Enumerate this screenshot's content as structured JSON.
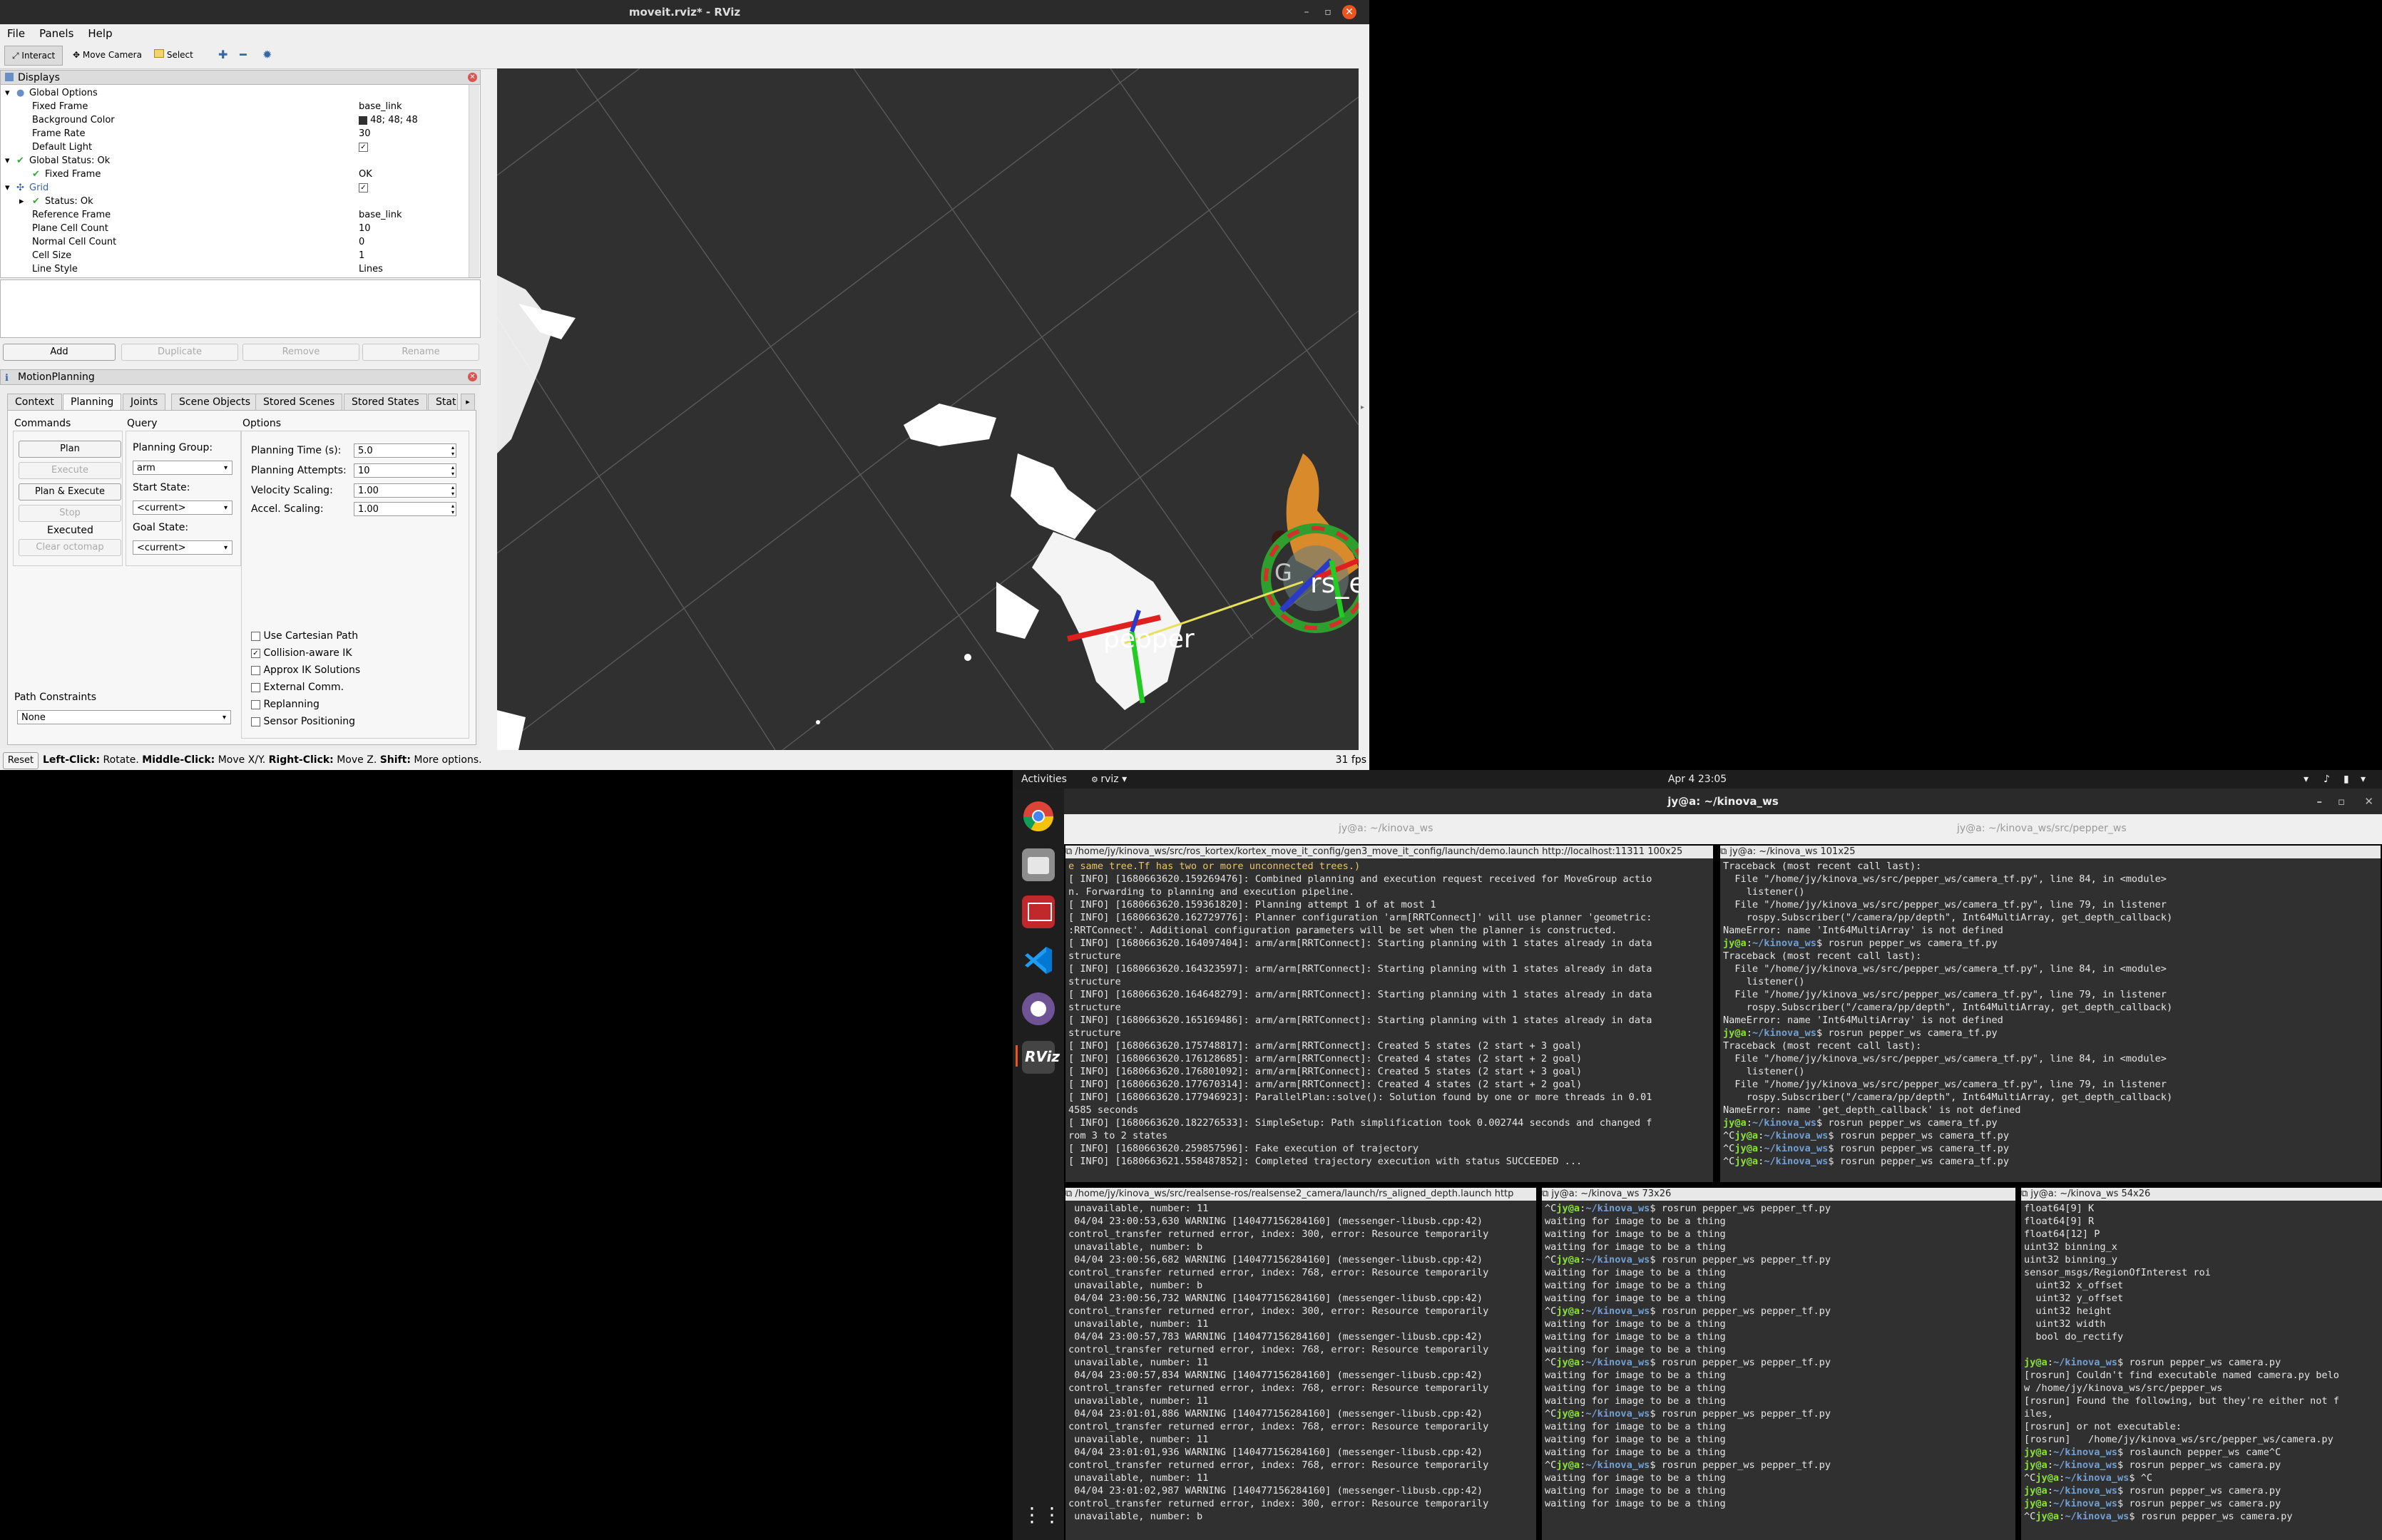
{
  "rviz": {
    "window_title": "moveit.rviz* - RViz",
    "menu": [
      "File",
      "Panels",
      "Help"
    ],
    "toolbar": {
      "interact": "Interact",
      "move_camera": "Move Camera",
      "select": "Select"
    },
    "displays": {
      "title": "Displays",
      "rows": [
        {
          "name": "Global Options",
          "value": ""
        },
        {
          "name": "Fixed Frame",
          "value": "base_link"
        },
        {
          "name": "Background Color",
          "value": "48; 48; 48"
        },
        {
          "name": "Frame Rate",
          "value": "30"
        },
        {
          "name": "Default Light",
          "value": ""
        },
        {
          "name": "Global Status: Ok",
          "value": ""
        },
        {
          "name": "Fixed Frame",
          "value": "OK"
        },
        {
          "name": "Grid",
          "value": ""
        },
        {
          "name": "Status: Ok",
          "value": ""
        },
        {
          "name": "Reference Frame",
          "value": "base_link"
        },
        {
          "name": "Plane Cell Count",
          "value": "10"
        },
        {
          "name": "Normal Cell Count",
          "value": "0"
        },
        {
          "name": "Cell Size",
          "value": "1"
        },
        {
          "name": "Line Style",
          "value": "Lines"
        }
      ],
      "buttons": {
        "add": "Add",
        "duplicate": "Duplicate",
        "remove": "Remove",
        "rename": "Rename"
      }
    },
    "motion_planning": {
      "title": "MotionPlanning",
      "tabs": [
        "Context",
        "Planning",
        "Joints",
        "Scene Objects",
        "Stored Scenes",
        "Stored States",
        "Stat"
      ],
      "commands": {
        "label": "Commands",
        "plan": "Plan",
        "execute": "Execute",
        "plan_execute": "Plan & Execute",
        "stop": "Stop",
        "status": "Executed",
        "clear_octomap": "Clear octomap"
      },
      "query": {
        "label": "Query",
        "planning_group_label": "Planning Group:",
        "planning_group": "arm",
        "start_state_label": "Start State:",
        "start_state": "<current>",
        "goal_state_label": "Goal State:",
        "goal_state": "<current>"
      },
      "options": {
        "label": "Options",
        "planning_time_label": "Planning Time (s):",
        "planning_time": "5.0",
        "planning_attempts_label": "Planning Attempts:",
        "planning_attempts": "10",
        "velocity_scaling_label": "Velocity Scaling:",
        "velocity_scaling": "1.00",
        "accel_scaling_label": "Accel. Scaling:",
        "accel_scaling": "1.00",
        "checkboxes": [
          {
            "label": "Use Cartesian Path",
            "checked": false
          },
          {
            "label": "Collision-aware IK",
            "checked": true
          },
          {
            "label": "Approx IK Solutions",
            "checked": false
          },
          {
            "label": "External Comm.",
            "checked": false
          },
          {
            "label": "Replanning",
            "checked": false
          },
          {
            "label": "Sensor Positioning",
            "checked": false
          }
        ]
      },
      "path_constraints_label": "Path Constraints",
      "path_constraints": "None"
    },
    "viewport": {
      "label_rs_ee": "rs_ee",
      "label_pepper": "pepper",
      "label_g": "G"
    },
    "statusbar": {
      "reset": "Reset",
      "hint_left": "Left-Click:",
      "hint_left_text": " Rotate. ",
      "hint_middle": "Middle-Click:",
      "hint_middle_text": " Move X/Y. ",
      "hint_right": "Right-Click:",
      "hint_right_text": " Move Z. ",
      "hint_shift": "Shift:",
      "hint_shift_text": " More options.",
      "fps": "31 fps"
    }
  },
  "desktop": {
    "activities": "Activities",
    "app_menu": "rviz ▾",
    "clock": "Apr 4  23:05",
    "dock_label_rviz": "RViz"
  },
  "terminal": {
    "window_title": "jy@a: ~/kinova_ws",
    "tabs": [
      "jy@a: ~/kinova_ws",
      "jy@a: ~/kinova_ws/src/pepper_ws"
    ],
    "pane1": {
      "header": "/home/jy/kinova_ws/src/ros_kortex/kortex_move_it_config/gen3_move_it_config/launch/demo.launch http://localhost:11311 100x25",
      "lines": [
        "e same tree.Tf has two or more unconnected trees.)",
        "[ INFO] [1680663620.159269476]: Combined planning and execution request received for MoveGroup actio",
        "n. Forwarding to planning and execution pipeline.",
        "[ INFO] [1680663620.159361820]: Planning attempt 1 of at most 1",
        "[ INFO] [1680663620.162729776]: Planner configuration 'arm[RRTConnect]' will use planner 'geometric:",
        ":RRTConnect'. Additional configuration parameters will be set when the planner is constructed.",
        "[ INFO] [1680663620.164097404]: arm/arm[RRTConnect]: Starting planning with 1 states already in data",
        "structure",
        "[ INFO] [1680663620.164323597]: arm/arm[RRTConnect]: Starting planning with 1 states already in data",
        "structure",
        "[ INFO] [1680663620.164648279]: arm/arm[RRTConnect]: Starting planning with 1 states already in data",
        "structure",
        "[ INFO] [1680663620.165169486]: arm/arm[RRTConnect]: Starting planning with 1 states already in data",
        "structure",
        "[ INFO] [1680663620.175748817]: arm/arm[RRTConnect]: Created 5 states (2 start + 3 goal)",
        "[ INFO] [1680663620.176128685]: arm/arm[RRTConnect]: Created 4 states (2 start + 2 goal)",
        "[ INFO] [1680663620.176801092]: arm/arm[RRTConnect]: Created 5 states (2 start + 3 goal)",
        "[ INFO] [1680663620.177670314]: arm/arm[RRTConnect]: Created 4 states (2 start + 2 goal)",
        "[ INFO] [1680663620.177946923]: ParallelPlan::solve(): Solution found by one or more threads in 0.01",
        "4585 seconds",
        "[ INFO] [1680663620.182276533]: SimpleSetup: Path simplification took 0.002744 seconds and changed f",
        "rom 3 to 2 states",
        "[ INFO] [1680663620.259857596]: Fake execution of trajectory",
        "[ INFO] [1680663621.558487852]: Completed trajectory execution with status SUCCEEDED ..."
      ]
    },
    "pane2": {
      "header": "jy@a: ~/kinova_ws 101x25",
      "lines": [
        "Traceback (most recent call last):",
        "  File \"/home/jy/kinova_ws/src/pepper_ws/camera_tf.py\", line 84, in <module>",
        "    listener()",
        "  File \"/home/jy/kinova_ws/src/pepper_ws/camera_tf.py\", line 79, in listener",
        "    rospy.Subscriber(\"/camera/pp/depth\", Int64MultiArray, get_depth_callback)",
        "NameError: name 'Int64MultiArray' is not defined",
        "jy@a:~/kinova_ws$ rosrun pepper_ws camera_tf.py",
        "Traceback (most recent call last):",
        "  File \"/home/jy/kinova_ws/src/pepper_ws/camera_tf.py\", line 84, in <module>",
        "    listener()",
        "  File \"/home/jy/kinova_ws/src/pepper_ws/camera_tf.py\", line 79, in listener",
        "    rospy.Subscriber(\"/camera/pp/depth\", Int64MultiArray, get_depth_callback)",
        "NameError: name 'Int64MultiArray' is not defined",
        "jy@a:~/kinova_ws$ rosrun pepper_ws camera_tf.py",
        "Traceback (most recent call last):",
        "  File \"/home/jy/kinova_ws/src/pepper_ws/camera_tf.py\", line 84, in <module>",
        "    listener()",
        "  File \"/home/jy/kinova_ws/src/pepper_ws/camera_tf.py\", line 79, in listener",
        "    rospy.Subscriber(\"/camera/pp/depth\", Int64MultiArray, get_depth_callback)",
        "NameError: name 'get_depth_callback' is not defined",
        "jy@a:~/kinova_ws$ rosrun pepper_ws camera_tf.py",
        "^Cjy@a:~/kinova_ws$ rosrun pepper_ws camera_tf.py",
        "^Cjy@a:~/kinova_ws$ rosrun pepper_ws camera_tf.py",
        "^Cjy@a:~/kinova_ws$ rosrun pepper_ws camera_tf.py"
      ]
    },
    "pane3": {
      "header": "/home/jy/kinova_ws/src/realsense-ros/realsense2_camera/launch/rs_aligned_depth.launch http",
      "lines": [
        " unavailable, number: 11",
        " 04/04 23:00:53,630 WARNING [140477156284160] (messenger-libusb.cpp:42)",
        "control_transfer returned error, index: 300, error: Resource temporarily",
        " unavailable, number: b",
        " 04/04 23:00:56,682 WARNING [140477156284160] (messenger-libusb.cpp:42)",
        "control_transfer returned error, index: 768, error: Resource temporarily",
        " unavailable, number: b",
        " 04/04 23:00:56,732 WARNING [140477156284160] (messenger-libusb.cpp:42)",
        "control_transfer returned error, index: 300, error: Resource temporarily",
        " unavailable, number: 11",
        " 04/04 23:00:57,783 WARNING [140477156284160] (messenger-libusb.cpp:42)",
        "control_transfer returned error, index: 768, error: Resource temporarily",
        " unavailable, number: 11",
        " 04/04 23:00:57,834 WARNING [140477156284160] (messenger-libusb.cpp:42)",
        "control_transfer returned error, index: 768, error: Resource temporarily",
        " unavailable, number: 11",
        " 04/04 23:01:01,886 WARNING [140477156284160] (messenger-libusb.cpp:42)",
        "control_transfer returned error, index: 768, error: Resource temporarily",
        " unavailable, number: 11",
        " 04/04 23:01:01,936 WARNING [140477156284160] (messenger-libusb.cpp:42)",
        "control_transfer returned error, index: 768, error: Resource temporarily",
        " unavailable, number: 11",
        " 04/04 23:01:02,987 WARNING [140477156284160] (messenger-libusb.cpp:42)",
        "control_transfer returned error, index: 300, error: Resource temporarily",
        " unavailable, number: b"
      ]
    },
    "pane4": {
      "header": "jy@a: ~/kinova_ws 73x26",
      "lines": [
        "^Cjy@a:~/kinova_ws$ rosrun pepper_ws pepper_tf.py",
        "waiting for image to be a thing",
        "waiting for image to be a thing",
        "waiting for image to be a thing",
        "^Cjy@a:~/kinova_ws$ rosrun pepper_ws pepper_tf.py",
        "waiting for image to be a thing",
        "waiting for image to be a thing",
        "waiting for image to be a thing",
        "^Cjy@a:~/kinova_ws$ rosrun pepper_ws pepper_tf.py",
        "waiting for image to be a thing",
        "waiting for image to be a thing",
        "waiting for image to be a thing",
        "^Cjy@a:~/kinova_ws$ rosrun pepper_ws pepper_tf.py",
        "waiting for image to be a thing",
        "waiting for image to be a thing",
        "waiting for image to be a thing",
        "^Cjy@a:~/kinova_ws$ rosrun pepper_ws pepper_tf.py",
        "waiting for image to be a thing",
        "waiting for image to be a thing",
        "waiting for image to be a thing",
        "^Cjy@a:~/kinova_ws$ rosrun pepper_ws pepper_tf.py",
        "waiting for image to be a thing",
        "waiting for image to be a thing",
        "waiting for image to be a thing"
      ]
    },
    "pane5": {
      "header": "jy@a: ~/kinova_ws 54x26",
      "lines": [
        "float64[9] K",
        "float64[9] R",
        "float64[12] P",
        "uint32 binning_x",
        "uint32 binning_y",
        "sensor_msgs/RegionOfInterest roi",
        "  uint32 x_offset",
        "  uint32 y_offset",
        "  uint32 height",
        "  uint32 width",
        "  bool do_rectify",
        "",
        "jy@a:~/kinova_ws$ rosrun pepper_ws camera.py",
        "[rosrun] Couldn't find executable named camera.py belo",
        "w /home/jy/kinova_ws/src/pepper_ws",
        "[rosrun] Found the following, but they're either not f",
        "iles,",
        "[rosrun] or not executable:",
        "[rosrun]   /home/jy/kinova_ws/src/pepper_ws/camera.py",
        "jy@a:~/kinova_ws$ roslaunch pepper_ws came^C",
        "jy@a:~/kinova_ws$ rosrun pepper_ws camera.py",
        "^Cjy@a:~/kinova_ws$ ^C",
        "jy@a:~/kinova_ws$ rosrun pepper_ws camera.py",
        "jy@a:~/kinova_ws$ rosrun pepper_ws camera.py",
        "^Cjy@a:~/kinova_ws$ rosrun pepper_ws camera.py"
      ]
    }
  }
}
